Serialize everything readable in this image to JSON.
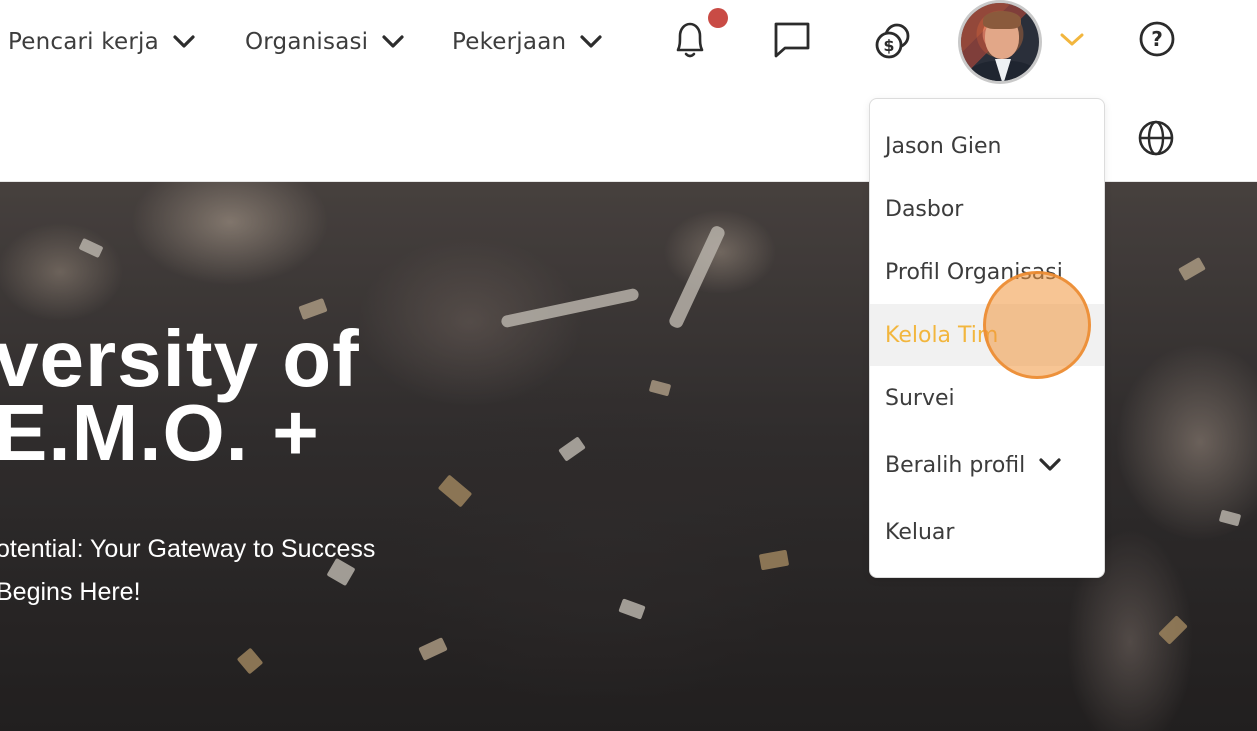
{
  "nav": {
    "items": [
      {
        "label": "Pencari kerja",
        "icon": "chevron-down-icon"
      },
      {
        "label": "Organisasi",
        "icon": "chevron-down-icon"
      },
      {
        "label": "Pekerjaan",
        "icon": "chevron-down-icon"
      }
    ],
    "icons": [
      "bell-icon",
      "chat-icon",
      "coins-icon",
      "avatar",
      "chevron-down-icon",
      "help-icon",
      "globe-icon"
    ],
    "notification_dot_color": "#c94b45",
    "accent_color": "#f2b63e"
  },
  "hero": {
    "title_line1": "versity of",
    "title_line2": "E.M.O. +",
    "subtitle_line1": "otential: Your Gateway to Success",
    "subtitle_line2": "Begins Here!"
  },
  "dropdown": {
    "user_name": "Jason Gien",
    "items": [
      {
        "label": "Dasbor"
      },
      {
        "label": "Profil Organisasi"
      },
      {
        "label": "Kelola Tim",
        "active": true
      },
      {
        "label": "Survei"
      },
      {
        "label": "Beralih profil"
      },
      {
        "label": "Keluar"
      }
    ]
  }
}
